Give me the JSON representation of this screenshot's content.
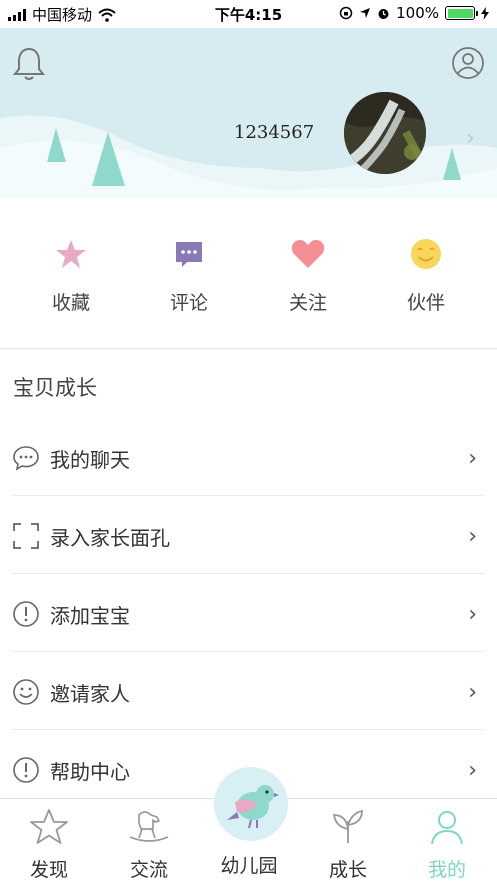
{
  "status_bar": {
    "carrier": "中国移动",
    "time": "下午4:15",
    "battery": "100%"
  },
  "header": {
    "username": "1234567",
    "icons": [
      "bell-icon",
      "user-circle-icon"
    ]
  },
  "quick_actions": [
    {
      "label": "收藏",
      "icon": "star-icon",
      "color": "#e7a9c4"
    },
    {
      "label": "评论",
      "icon": "comment-icon",
      "color": "#8a79b8"
    },
    {
      "label": "关注",
      "icon": "heart-icon",
      "color": "#f58f95"
    },
    {
      "label": "伙伴",
      "icon": "smiley-icon",
      "color": "#f8d65a"
    }
  ],
  "section": {
    "title": "宝贝成长"
  },
  "menu": [
    {
      "label": "我的聊天",
      "icon": "chat-bubble-icon"
    },
    {
      "label": "录入家长面孔",
      "icon": "scan-frame-icon"
    },
    {
      "label": "添加宝宝",
      "icon": "exclamation-circle-icon"
    },
    {
      "label": "邀请家人",
      "icon": "smile-face-icon"
    },
    {
      "label": "帮助中心",
      "icon": "exclamation-circle-icon"
    }
  ],
  "tabs": [
    {
      "label": "发现",
      "icon": "star-outline-icon"
    },
    {
      "label": "交流",
      "icon": "rocking-horse-icon"
    },
    {
      "label": "幼儿园",
      "icon": "bird-icon"
    },
    {
      "label": "成长",
      "icon": "leaf-icon"
    },
    {
      "label": "我的",
      "icon": "person-icon",
      "active": true
    }
  ],
  "colors": {
    "header_bg": "#d7ecf1",
    "accent": "#7fd5c8",
    "tree": "#8fd8cc"
  }
}
